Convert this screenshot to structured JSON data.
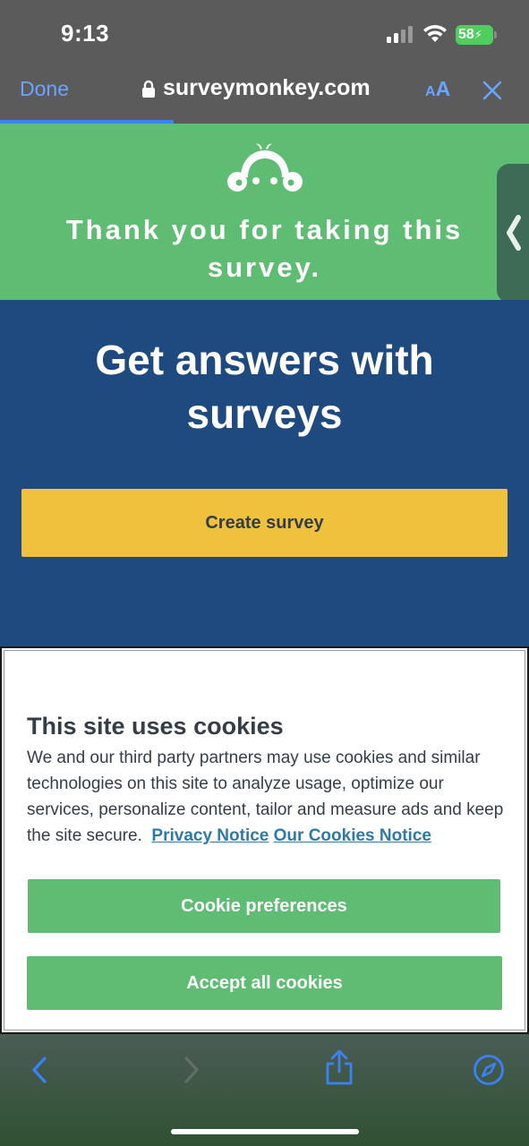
{
  "status_bar": {
    "time": "9:13",
    "battery": "58",
    "icons": [
      "cellular-signal-icon",
      "wifi-icon",
      "battery-charging-icon"
    ]
  },
  "browser_header": {
    "done_label": "Done",
    "url": "surveymonkey.com",
    "text_size_small": "A",
    "text_size_large": "A",
    "accent_color": "#6aa4ff",
    "icons": [
      "lock-icon",
      "close-icon"
    ]
  },
  "banner": {
    "title": "Thank you for taking this survey.",
    "background": "#5ebc73",
    "icons": [
      "surveymonkey-logo-icon",
      "chevron-left-icon"
    ]
  },
  "hero": {
    "title": "Get answers with surveys",
    "create_button": "Create survey",
    "background": "#1f4a80",
    "button_color": "#f0c13d"
  },
  "cookie_notice": {
    "title": "This site uses cookies",
    "body": "We and our third party partners may use cookies and similar technologies on this site to analyze usage, optimize our services, personalize content, tailor and measure ads and keep the site secure.",
    "privacy_link": "Privacy Notice",
    "cookies_link": "Our Cookies Notice",
    "preferences_button": "Cookie preferences",
    "accept_button": "Accept all cookies",
    "link_color": "#2d7aa8"
  },
  "toolbar": {
    "icons": [
      "back-arrow-icon",
      "forward-arrow-icon",
      "share-icon",
      "compass-icon"
    ]
  }
}
